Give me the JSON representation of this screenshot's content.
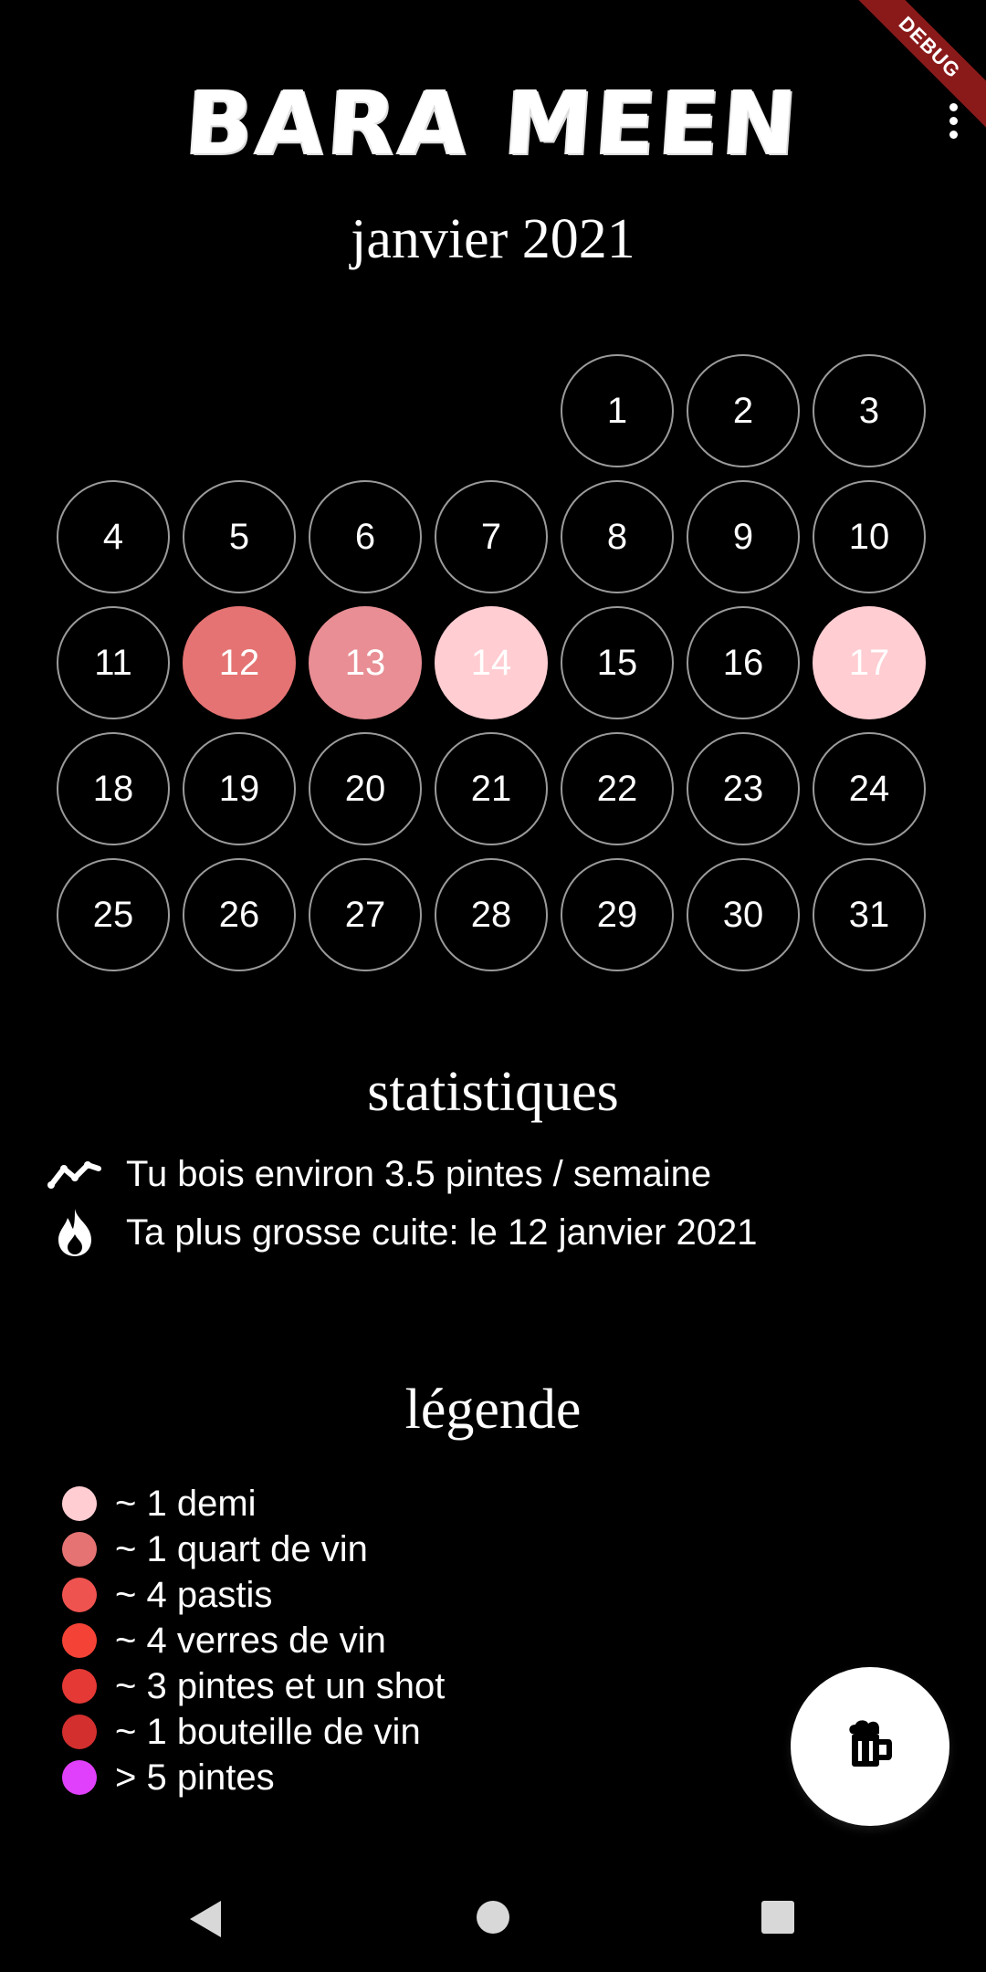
{
  "app": {
    "title": "BARA MEEN",
    "debug_label": "DEBUG"
  },
  "calendar": {
    "month_label": "janvier 2021",
    "leading_blanks": 4,
    "days": [
      {
        "label": "1",
        "color": null
      },
      {
        "label": "2",
        "color": null
      },
      {
        "label": "3",
        "color": null
      },
      {
        "label": "4",
        "color": null
      },
      {
        "label": "5",
        "color": null
      },
      {
        "label": "6",
        "color": null
      },
      {
        "label": "7",
        "color": null
      },
      {
        "label": "8",
        "color": null
      },
      {
        "label": "9",
        "color": null
      },
      {
        "label": "10",
        "color": null
      },
      {
        "label": "11",
        "color": null
      },
      {
        "label": "12",
        "color": "#e57373"
      },
      {
        "label": "13",
        "color": "#e88e94"
      },
      {
        "label": "14",
        "color": "#ffcdd2"
      },
      {
        "label": "15",
        "color": null
      },
      {
        "label": "16",
        "color": null
      },
      {
        "label": "17",
        "color": "#ffcdd2"
      },
      {
        "label": "18",
        "color": null
      },
      {
        "label": "19",
        "color": null
      },
      {
        "label": "20",
        "color": null
      },
      {
        "label": "21",
        "color": null
      },
      {
        "label": "22",
        "color": null
      },
      {
        "label": "23",
        "color": null
      },
      {
        "label": "24",
        "color": null
      },
      {
        "label": "25",
        "color": null
      },
      {
        "label": "26",
        "color": null
      },
      {
        "label": "27",
        "color": null
      },
      {
        "label": "28",
        "color": null
      },
      {
        "label": "29",
        "color": null
      },
      {
        "label": "30",
        "color": null
      },
      {
        "label": "31",
        "color": null
      }
    ]
  },
  "stats": {
    "title": "statistiques",
    "items": [
      {
        "icon": "trending-line-icon",
        "text": "Tu bois environ 3.5 pintes / semaine"
      },
      {
        "icon": "flame-icon",
        "text": "Ta plus grosse cuite: le 12 janvier 2021"
      }
    ]
  },
  "legend": {
    "title": "légende",
    "items": [
      {
        "color": "#ffcdd2",
        "text": "~ 1 demi"
      },
      {
        "color": "#e57373",
        "text": "~ 1 quart de vin"
      },
      {
        "color": "#ef5350",
        "text": "~ 4 pastis"
      },
      {
        "color": "#f44336",
        "text": "~ 4 verres de vin"
      },
      {
        "color": "#e53935",
        "text": "~ 3 pintes et un shot"
      },
      {
        "color": "#d32f2f",
        "text": "~ 1 bouteille de vin"
      },
      {
        "color": "#e040fb",
        "text": "> 5 pintes"
      }
    ]
  },
  "fab": {
    "icon": "beer-mug-icon"
  },
  "navbar": {
    "back_icon": "back-triangle-icon",
    "home_icon": "home-circle-icon",
    "recent_icon": "recent-square-icon"
  }
}
